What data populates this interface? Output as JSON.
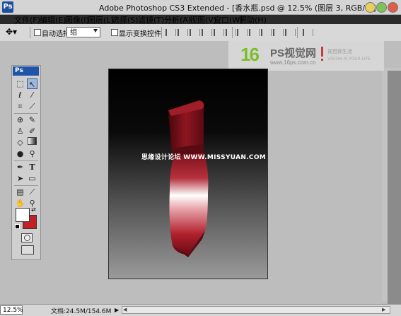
{
  "app": {
    "icon": "Ps",
    "title": "Adobe Photoshop CS3 Extended - [香水瓶.psd @ 12.5% (图层 3, RGB/8)]"
  },
  "window_controls": [
    "minimize-icon",
    "maximize-icon",
    "close-icon"
  ],
  "menu": {
    "file": "文件(F)",
    "edit": "编辑(E)",
    "image": "图像(I)",
    "layer": "图层(L)",
    "select": "选择(S)",
    "filter": "滤镜(T)",
    "analysis": "分析(A)",
    "view": "视图(V)",
    "window": "窗口(W)",
    "help": "帮助(H)"
  },
  "options": {
    "tool_preset": "move-tool-icon",
    "auto_select_label": "自动选择:",
    "auto_select_value": "组",
    "show_transform_label": "显示变换控件"
  },
  "watermark": {
    "number": "16",
    "brand": "PS视觉网",
    "url": "www.16ps.com.cn",
    "slogan": "视觉即生活",
    "slogan_en": "VISION IS YOUR LIFE"
  },
  "toolbox": {
    "title": "Ps",
    "tools": [
      "marquee-icon",
      "move-icon",
      "lasso-icon",
      "magic-wand-icon",
      "crop-icon",
      "slice-icon",
      "healing-brush-icon",
      "brush-icon",
      "clone-stamp-icon",
      "history-brush-icon",
      "eraser-icon",
      "gradient-icon",
      "blur-icon",
      "dodge-icon",
      "pen-icon",
      "type-icon",
      "path-select-icon",
      "shape-icon",
      "notes-icon",
      "eyedropper-icon",
      "hand-icon",
      "zoom-icon"
    ],
    "type_glyph": "T",
    "foreground_color": "#ffffff",
    "background_color": "#c32026"
  },
  "canvas": {
    "watermark_text": "思缘设计论坛 WWW.MISSYUAN.COM",
    "bottle_color": "#8e1620"
  },
  "status": {
    "zoom": "12.5%",
    "doc_info": "文档:24.5M/154.6M",
    "arrow": "▶",
    "scroll_left": "◀",
    "scroll_right": "▶"
  }
}
